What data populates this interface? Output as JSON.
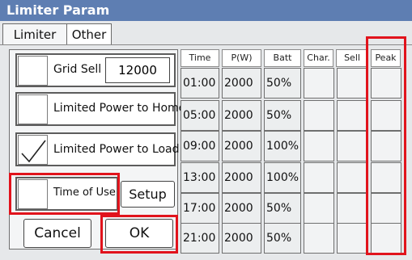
{
  "title": "Limiter Param",
  "tabs": [
    "Limiter",
    "Other"
  ],
  "settings": {
    "grid_sell_label": "Grid Sell",
    "grid_sell_value": "12000",
    "limited_home_label": "Limited Power to Home",
    "limited_load_label": "Limited Power to Load",
    "time_of_use_label": "Time of Use",
    "setup_label": "Setup"
  },
  "buttons": {
    "cancel": "Cancel",
    "ok": "OK"
  },
  "table": {
    "headers": [
      "Time",
      "P(W)",
      "Batt",
      "Char.",
      "Sell",
      "Peak"
    ],
    "rows": [
      {
        "time": "01:00",
        "power": "2000",
        "batt": "50%"
      },
      {
        "time": "05:00",
        "power": "2000",
        "batt": "50%"
      },
      {
        "time": "09:00",
        "power": "2000",
        "batt": "100%"
      },
      {
        "time": "13:00",
        "power": "2000",
        "batt": "100%"
      },
      {
        "time": "17:00",
        "power": "2000",
        "batt": "50%"
      },
      {
        "time": "21:00",
        "power": "2000",
        "batt": "50%"
      }
    ]
  },
  "colors": {
    "title_bar": "#5e7eb2",
    "highlight": "#e1131c"
  },
  "icons": {
    "checked": "check-icon"
  }
}
